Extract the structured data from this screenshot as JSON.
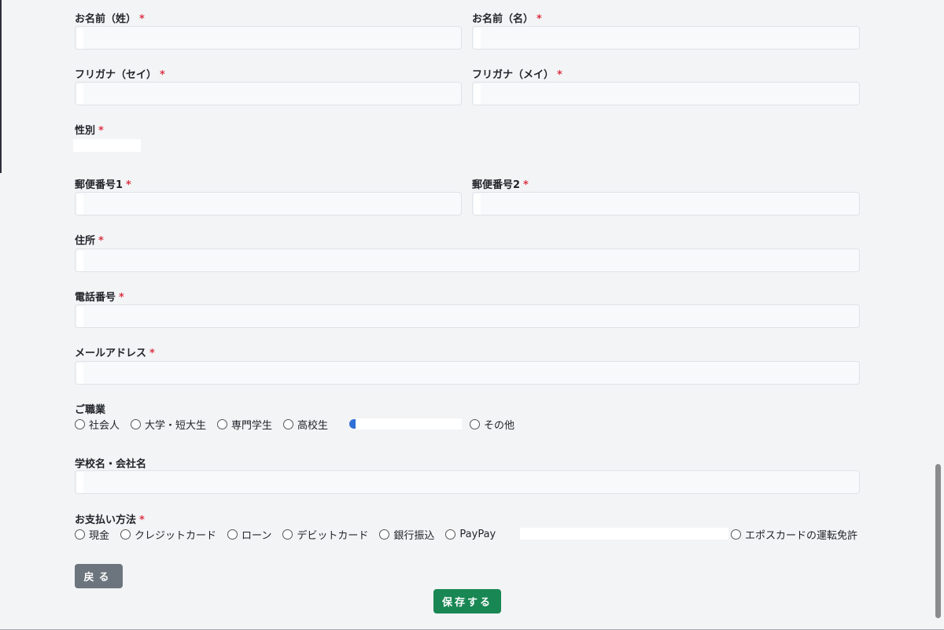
{
  "fields": {
    "last_name": {
      "label": "お名前（姓）",
      "required": "*"
    },
    "first_name": {
      "label": "お名前（名）",
      "required": "*"
    },
    "last_kana": {
      "label": "フリガナ（セイ）",
      "required": "*"
    },
    "first_kana": {
      "label": "フリガナ（メイ）",
      "required": "*"
    },
    "gender": {
      "label": "性別",
      "required": "*"
    },
    "postal1": {
      "label": "郵便番号1",
      "required": "*"
    },
    "postal2": {
      "label": "郵便番号2",
      "required": "*"
    },
    "address": {
      "label": "住所",
      "required": "*"
    },
    "phone": {
      "label": "電話番号",
      "required": "*"
    },
    "email": {
      "label": "メールアドレス",
      "required": "*"
    },
    "school": {
      "label": "学校名・会社名"
    }
  },
  "occupation": {
    "label": "ご職業",
    "options": [
      "社会人",
      "大学・短大生",
      "専門学生",
      "高校生",
      "その他"
    ]
  },
  "payment": {
    "label": "お支払い方法",
    "required": "*",
    "options": [
      "現金",
      "クレジットカード",
      "ローン",
      "デビットカード",
      "銀行振込",
      "PayPay",
      "エポスカードの運転免許"
    ]
  },
  "buttons": {
    "back": "戻る",
    "save": "保存する"
  },
  "colors": {
    "background": "#f3f4f6",
    "required": "#dc3545",
    "back_button": "#6c757d",
    "save_button": "#198754"
  }
}
